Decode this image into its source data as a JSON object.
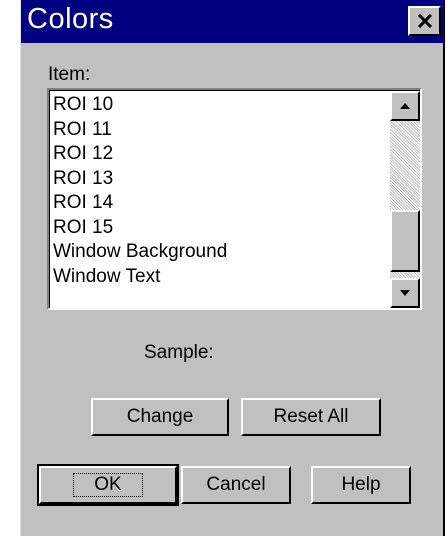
{
  "window": {
    "title": "Colors"
  },
  "item_label": "Item:",
  "items": [
    "ROI 10",
    "ROI 11",
    "ROI 12",
    "ROI 13",
    "ROI 14",
    "ROI 15",
    "Window Background",
    "Window Text"
  ],
  "sample_label": "Sample:",
  "buttons": {
    "change": "Change",
    "reset_all": "Reset All",
    "ok": "OK",
    "cancel": "Cancel",
    "help": "Help"
  },
  "colors": {
    "titlebar": "#000080",
    "face": "#c0c0c0"
  }
}
